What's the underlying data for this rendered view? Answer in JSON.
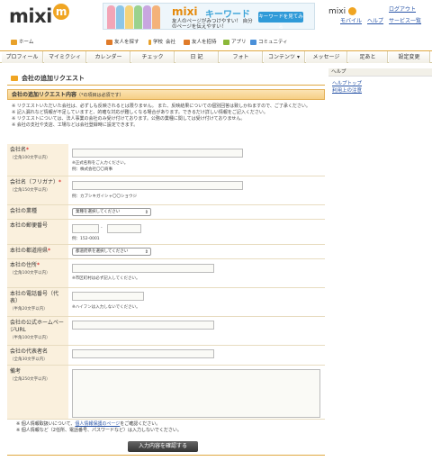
{
  "header": {
    "logo_text": "mixi",
    "logo_badge": "m",
    "banner": {
      "brand": "mixi",
      "keyword": "キーワード",
      "sub": "友人のページがみつけやすい！ 自分のページを伝えやすい！",
      "button": "キーワードを見てみる"
    },
    "mixi_small": "mixi",
    "logout": "ログアウト",
    "links": [
      "モバイル",
      "ヘルプ",
      "サービス一覧"
    ]
  },
  "nav": {
    "items": [
      "ホーム",
      "友人を探す",
      "学校",
      "会社",
      "友人を招待",
      "アプリ",
      "コミュニティ"
    ]
  },
  "menu": {
    "items": [
      "プロフィール",
      "マイミクシィ",
      "カレンダー",
      "チェック",
      "日 記",
      "フォト",
      "コンテンツ",
      "メッセージ",
      "足あと",
      "設定変更"
    ]
  },
  "sidebar": {
    "title": "ヘルプ",
    "links": [
      "ヘルプトップ",
      "利用上の注意"
    ]
  },
  "page": {
    "title": "会社の追加リクエスト",
    "section_title": "会社の追加リクエスト内容",
    "section_note": "（*の項目は必須です）",
    "notes": [
      "※ リクエストいただいた会社は、必ずしも反映されるとは限りません。 また、反映結果についての個別回答は致しかねますので、ご了承ください。",
      "※ 記入漏れなど情報が不足していますと、的確な対応が難しくなる場合があります。できるだけ詳しい情報をご記入ください。",
      "※ リクエストについては、法人事業の会社のみ受け付けております。公務の業種に関しては受け付けておりません。",
      "※ 会社の支社や支店、工場などは会社登録時に設定できます。"
    ]
  },
  "form": {
    "company_name": {
      "label": "会社名",
      "sub": "（全角100文字以内）",
      "note1": "※正式名称をご入力ください。",
      "note2": "例：株式会社〇〇商事"
    },
    "company_kana": {
      "label": "会社名（フリガナ）",
      "sub": "（全角150文字以内）",
      "note": "例：カブシキガイシャ〇〇ショウジ"
    },
    "industry": {
      "label": "会社の業種",
      "select": "業種を選択してください"
    },
    "postal": {
      "label": "本社の郵便番号",
      "note": "例：152-0001",
      "sep": "-"
    },
    "prefecture": {
      "label": "本社の都道府県",
      "select": "都道府県を選択してください"
    },
    "address": {
      "label": "本社の住所",
      "sub": "（全角100文字以内）",
      "note": "※市区町村は必ず記入してください。"
    },
    "phone": {
      "label": "本社の電話番号（代表）",
      "sub": "（半角20文字以内）",
      "note": "※ハイフンは入力しないでください。"
    },
    "homepage": {
      "label": "会社の公式ホームページURL",
      "sub": "（半角100文字以内）"
    },
    "rep": {
      "label": "会社の代表者名",
      "sub": "（全角30文字以内）"
    },
    "remarks": {
      "label": "備考",
      "sub": "（全角250文字以内）"
    }
  },
  "footer": {
    "line1_pre": "※ 個人情報取扱いについて、",
    "line1_link": "個人情報保護のページ",
    "line1_post": "をご確認ください。",
    "line2": "※ 個人情報など（2任所、電話番号、パスワードなど）は入力しないでください。",
    "submit": "入力内容を確認する"
  },
  "colors": {
    "accent": "#f0a522",
    "link": "#2a55a7",
    "label_bg": "#faf0dd",
    "required": "#d40000"
  }
}
